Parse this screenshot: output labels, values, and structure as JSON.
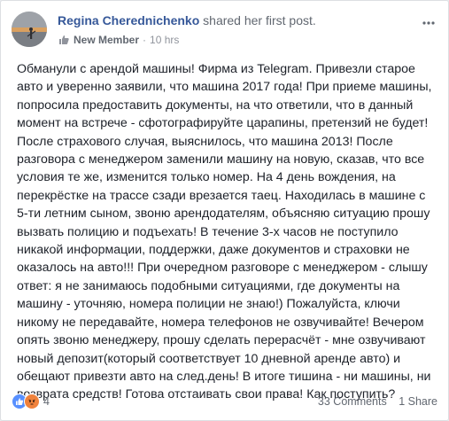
{
  "post": {
    "author": "Regina Cherednichenko",
    "action": "shared her first post.",
    "badge": "New Member",
    "separator": "·",
    "time": "10 hrs",
    "text": "Обманули с арендой машины! Фирма из Telegram. Привезли старое\nавто и уверенно заявили, что машина 2017 года! При приеме машины,\nпопросила предоставить документы, на что ответили, что в данный\nмомент на встрече - сфотографируйте царапины, претензий не будет!\nПосле страхового случая, выяснилось, что машина 2013! После\nразговора с менеджером заменили машину на новую, сказав, что все\nусловия те же, изменится только номер. На 4 день вождения, на\nперекрёстке на трассе сзади врезается таец. Находилась в машине с\n5-ти летним сыном, звоню арендодателям, объясняю ситуацию прошу\nвызвать полицию и подъехать! В течение 3-х часов не поступило\nникакой информации, поддержки, даже документов и страховки не\nоказалось на авто!!! При очередном разговоре с менеджером - слышу\nответ: я не занимаюсь подобными ситуациями, где документы на\nмашину - уточняю, номера полиции не знаю!) Пожалуйста, ключи\nникому не передавайте, номера телефонов не озвучивайте! Вечером\nопять звоню менеджеру, прошу сделать перерасчёт - мне озвучивают\nновый депозит(который соответствует 10 дневной аренде авто) и\nобещают привезти авто на след.день! В итоге тишина - ни машины, ни\nвозврата средств! Готова отстаивать свои права! Как поступить?"
  },
  "footer": {
    "reaction_count": "4",
    "comments": "33 Comments",
    "shares": "1 Share"
  },
  "colors": {
    "link": "#365899",
    "like": "#5890ff",
    "angry": "#f0823c"
  },
  "icons": [
    "avatar",
    "new-member-icon",
    "more-options-icon",
    "like-reaction-icon",
    "angry-reaction-icon"
  ]
}
